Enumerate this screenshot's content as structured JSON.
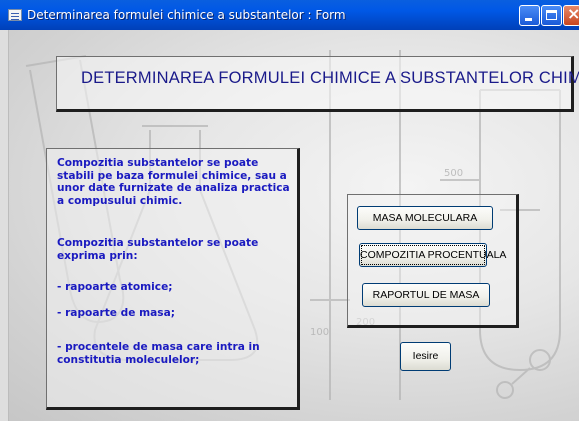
{
  "window": {
    "title": "Determinarea formulei chimice a substantelor : Form"
  },
  "header": {
    "title": "DETERMINAREA FORMULEI CHIMICE A SUBSTANTELOR CHIMICE"
  },
  "info": {
    "paragraph1": "Compozitia substantelor se poate stabili pe baza formulei chimice, sau a unor date furnizate de analiza practica a compusului chimic.",
    "paragraph2": "Compozitia substantelor se poate exprima prin:",
    "item1": "- rapoarte atomice;",
    "item2": "- rapoarte de masa;",
    "item3": "- procentele de masa care intra in constitutia moleculelor;"
  },
  "buttons": {
    "masa_moleculara": "MASA MOLECULARA",
    "compozitia_procentuala": "COMPOZITIA PROCENTUALA",
    "raportul_de_masa": "RAPORTUL DE MASA",
    "iesire": "Iesire"
  },
  "colors": {
    "title_bar": "#0058e6",
    "header_text": "#1a1a8a",
    "info_text": "#1a1ac0",
    "background": "#dcdcdc"
  }
}
